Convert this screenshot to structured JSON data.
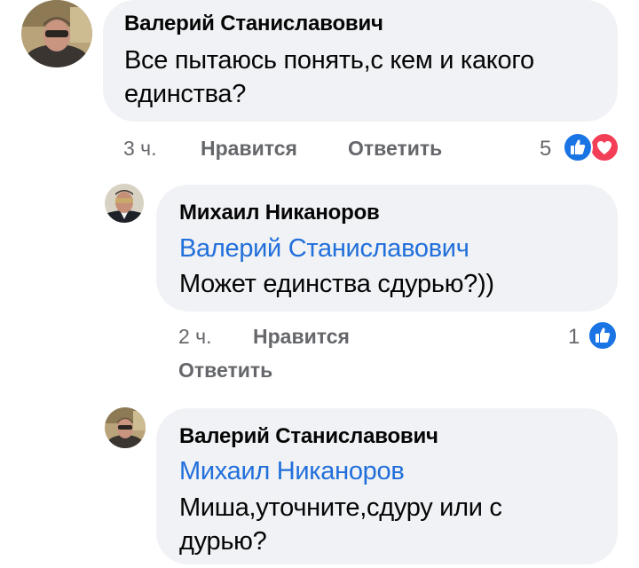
{
  "comments": [
    {
      "author": "Валерий Станиславович",
      "text": "Все пытаюсь понять,с кем и какого единства?",
      "time": "3 ч.",
      "like_label": "Нравится",
      "reply_label": "Ответить",
      "reaction_count": "5",
      "reactions": [
        "like-icon",
        "love-icon"
      ]
    },
    {
      "author": "Михаил Никаноров",
      "mention": "Валерий Станиславович",
      "text": "Может единства сдурью?))",
      "time": "2 ч.",
      "like_label": "Нравится",
      "reply_label": "Ответить",
      "reaction_count": "1",
      "reactions": [
        "like-icon"
      ]
    },
    {
      "author": "Валерий Станиславович",
      "mention": "Михаил Никаноров",
      "text": "Миша,уточните,сдуру или с дурью?"
    }
  ],
  "colors": {
    "bubble": "#f0f2f5",
    "mention": "#216fdb",
    "meta": "#65676b",
    "like": "#1b74e4",
    "love": "#f33e58"
  }
}
